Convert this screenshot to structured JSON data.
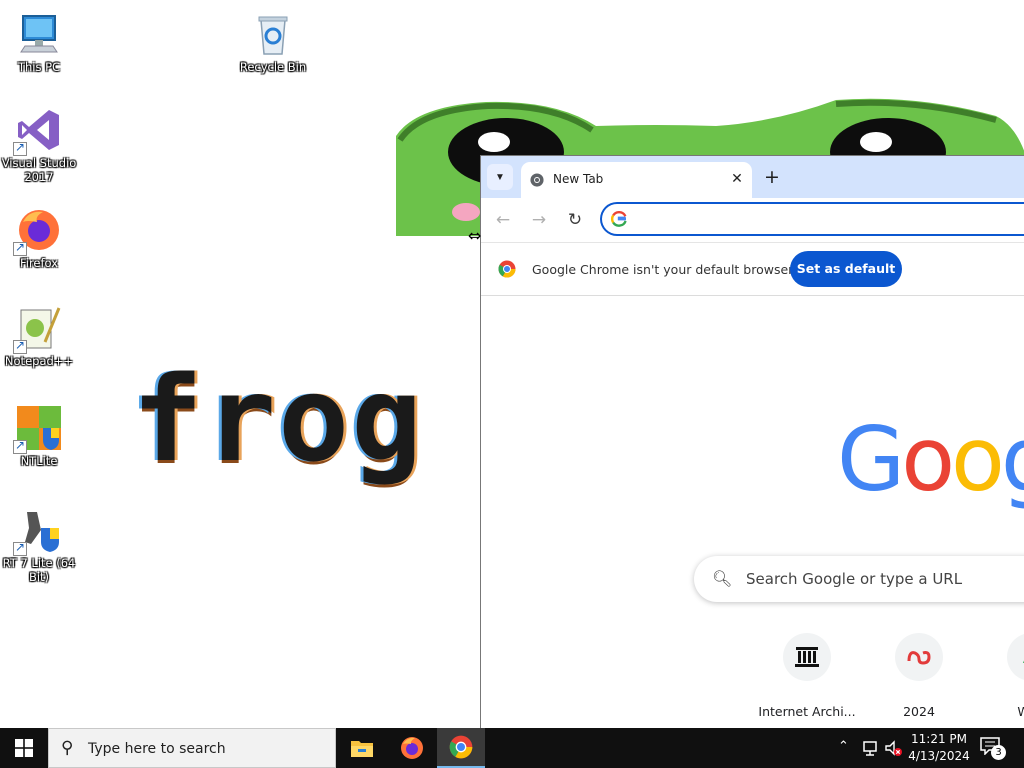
{
  "desktop": {
    "icons": [
      {
        "label": "This PC",
        "icon": "this-pc-icon"
      },
      {
        "label": "Recycle Bin",
        "icon": "recycle-bin-icon"
      },
      {
        "label": "Visual Studio 2017",
        "icon": "visual-studio-icon"
      },
      {
        "label": "Firefox",
        "icon": "firefox-icon"
      },
      {
        "label": "Notepad++",
        "icon": "notepad-plus-plus-icon"
      },
      {
        "label": "NTLite",
        "icon": "ntlite-icon"
      },
      {
        "label": "RT 7 Lite (64 Bit)",
        "icon": "rt7lite-icon"
      }
    ],
    "wallpaper_text": "frog is"
  },
  "chrome": {
    "tab": {
      "title": "New Tab"
    },
    "infobar": {
      "message": "Google Chrome isn't your default browser",
      "button": "Set as default"
    },
    "search_placeholder": "Search Google or type a URL",
    "logo_letters": [
      {
        "ch": "G",
        "color": "#4285f4"
      },
      {
        "ch": "o",
        "color": "#ea4335"
      },
      {
        "ch": "o",
        "color": "#fbbc05"
      },
      {
        "ch": "g",
        "color": "#4285f4"
      }
    ],
    "shortcuts": [
      {
        "name": "Internet Archi...",
        "icon": "internet-archive-icon"
      },
      {
        "name": "2024",
        "icon": "site-2024-icon"
      },
      {
        "name": "Web",
        "icon": "web-store-icon"
      }
    ]
  },
  "taskbar": {
    "search_placeholder": "Type here to search",
    "apps": [
      "file-explorer-icon",
      "firefox-icon",
      "chrome-icon"
    ],
    "clock": {
      "time": "11:21 PM",
      "date": "4/13/2024"
    },
    "notifications": "3"
  }
}
